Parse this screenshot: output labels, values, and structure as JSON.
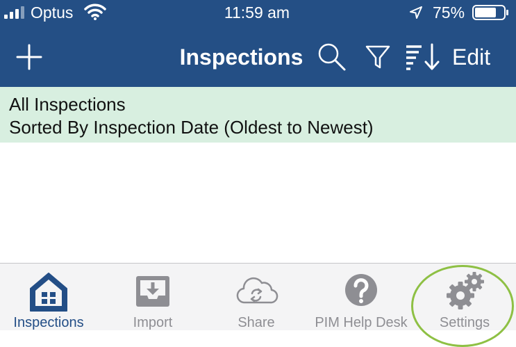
{
  "status_bar": {
    "carrier": "Optus",
    "time": "11:59 am",
    "battery_percent": "75%",
    "battery_level": 0.75,
    "icons": [
      "signal-icon",
      "wifi-icon",
      "location-arrow-icon",
      "battery-icon"
    ]
  },
  "nav_bar": {
    "title": "Inspections",
    "edit_label": "Edit",
    "icons": [
      "plus-icon",
      "search-icon",
      "filter-icon",
      "sort-icon"
    ]
  },
  "banner": {
    "line1": "All Inspections",
    "line2": "Sorted By Inspection Date (Oldest to Newest)"
  },
  "tabs": [
    {
      "label": "Inspections",
      "icon": "home-icon",
      "active": true
    },
    {
      "label": "Import",
      "icon": "import-tray-icon",
      "active": false
    },
    {
      "label": "Share",
      "icon": "cloud-sync-icon",
      "active": false
    },
    {
      "label": "PIM Help Desk",
      "icon": "help-circle-icon",
      "active": false
    },
    {
      "label": "Settings",
      "icon": "gear-icon",
      "active": false
    }
  ],
  "colors": {
    "header_background": "#244f85",
    "banner_background": "#d8efe0",
    "tab_active": "#234e86",
    "tab_inactive": "#8e8e93",
    "highlight_ring": "#8ec044"
  }
}
